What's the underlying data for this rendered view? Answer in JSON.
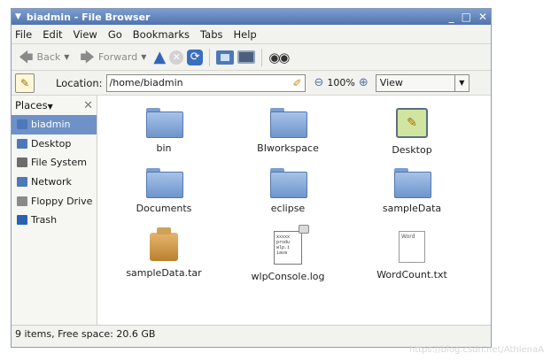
{
  "window": {
    "title": "biadmin - File Browser",
    "controls": [
      "_",
      "□",
      "✕"
    ]
  },
  "menu": [
    "File",
    "Edit",
    "View",
    "Go",
    "Bookmarks",
    "Tabs",
    "Help"
  ],
  "toolbar": {
    "back_label": "Back",
    "forward_label": "Forward"
  },
  "location": {
    "label": "Location:",
    "path": "/home/biadmin",
    "zoom": "100%",
    "view_mode": "View"
  },
  "sidebar": {
    "header": "Places",
    "items": [
      {
        "label": "biadmin",
        "icon": "home-folder-icon",
        "color": "#4d79b8",
        "selected": true
      },
      {
        "label": "Desktop",
        "icon": "desktop-icon",
        "color": "#4d79b8"
      },
      {
        "label": "File System",
        "icon": "harddrive-icon",
        "color": "#6d6d6d"
      },
      {
        "label": "Network",
        "icon": "network-icon",
        "color": "#4d79b8"
      },
      {
        "label": "Floppy Drive",
        "icon": "floppy-icon",
        "color": "#8a8a8a"
      },
      {
        "label": "Trash",
        "icon": "trash-icon",
        "color": "#2a62b0"
      }
    ]
  },
  "files": [
    {
      "name": "bin",
      "type": "folder"
    },
    {
      "name": "BIworkspace",
      "type": "folder"
    },
    {
      "name": "Desktop",
      "type": "desktop"
    },
    {
      "name": "Documents",
      "type": "folder"
    },
    {
      "name": "eclipse",
      "type": "folder"
    },
    {
      "name": "sampleData",
      "type": "folder"
    },
    {
      "name": "sampleData.tar",
      "type": "archive"
    },
    {
      "name": "wlpConsole.log",
      "type": "log",
      "preview": "xxxxx\nprodu\nwlp.i\niava"
    },
    {
      "name": "WordCount.txt",
      "type": "text",
      "preview": "Word"
    }
  ],
  "status": "9 items, Free space: 20.6 GB",
  "watermark": "https://blog.csdn.net/AthlenaA",
  "colors": {
    "title_bar": "#5a7db8",
    "selection": "#6e92c8",
    "folder": "#86a9da"
  }
}
